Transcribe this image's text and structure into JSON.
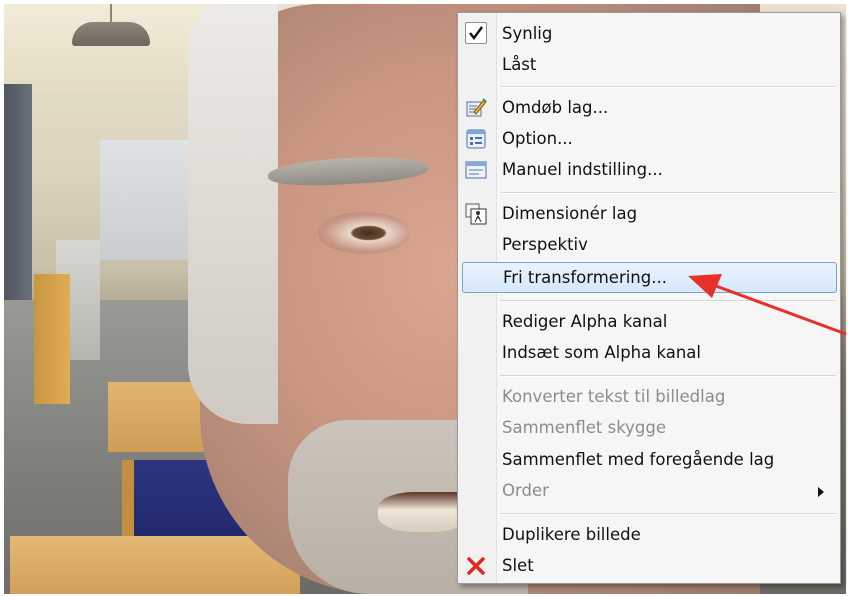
{
  "context_menu": {
    "items": [
      {
        "label": "Synlig",
        "icon": "checkmark-icon",
        "checked": true,
        "enabled": true
      },
      {
        "label": "Låst",
        "icon": null,
        "enabled": true
      },
      {
        "label": "Omdøb lag...",
        "icon": "rename-layer-icon",
        "enabled": true
      },
      {
        "label": "Option...",
        "icon": "options-dialog-icon",
        "enabled": true
      },
      {
        "label": "Manuel indstilling...",
        "icon": "manual-settings-icon",
        "enabled": true
      },
      {
        "label": "Dimensionér lag",
        "icon": "resize-layer-icon",
        "enabled": true
      },
      {
        "label": "Perspektiv",
        "icon": null,
        "enabled": true
      },
      {
        "label": "Fri transformering...",
        "icon": null,
        "enabled": true,
        "highlighted": true
      },
      {
        "label": "Rediger Alpha kanal",
        "icon": null,
        "enabled": true
      },
      {
        "label": "Indsæt som Alpha kanal",
        "icon": null,
        "enabled": true
      },
      {
        "label": "Konverter tekst til billedlag",
        "icon": null,
        "enabled": false
      },
      {
        "label": "Sammenflet skygge",
        "icon": null,
        "enabled": false
      },
      {
        "label": "Sammenflet med foregående lag",
        "icon": null,
        "enabled": true
      },
      {
        "label": "Order",
        "icon": null,
        "enabled": false,
        "submenu": true
      },
      {
        "label": "Duplikere billede",
        "icon": null,
        "enabled": true
      },
      {
        "label": "Slet",
        "icon": "delete-x-icon",
        "enabled": true
      }
    ]
  },
  "colors": {
    "highlight_border": "#7da2ce",
    "disabled_text": "#8c8c8c",
    "annotation_arrow": "#e8302a",
    "delete_icon": "#e0281e"
  }
}
